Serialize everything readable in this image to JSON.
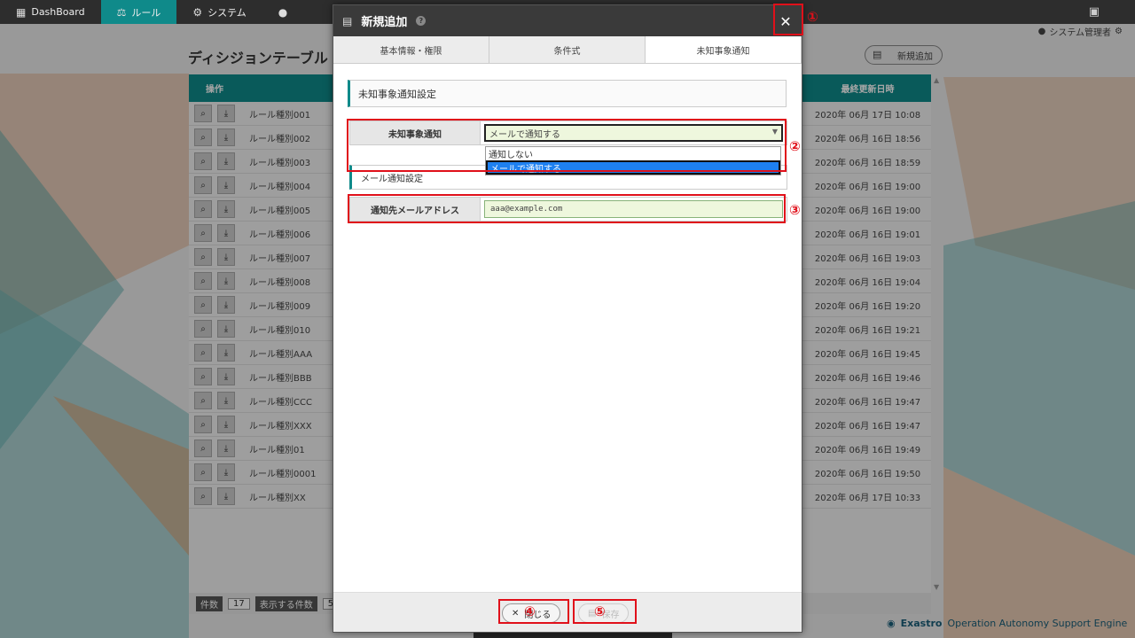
{
  "nav": {
    "items": [
      {
        "label": "DashBoard",
        "icon": "dashboard-icon",
        "active": false
      },
      {
        "label": "ルール",
        "icon": "scale-icon",
        "active": true
      },
      {
        "label": "システム",
        "icon": "gears-icon",
        "active": false
      }
    ]
  },
  "user": {
    "label": "システム管理者"
  },
  "page": {
    "title": "ディシジョンテーブル",
    "new_add_label": "新規追加"
  },
  "table": {
    "col_op": "操作",
    "col_date": "最終更新日時",
    "rows": [
      {
        "name": "ルール種別001",
        "date": "2020年 06月 17日 10:08"
      },
      {
        "name": "ルール種別002",
        "date": "2020年 06月 16日 18:56"
      },
      {
        "name": "ルール種別003",
        "date": "2020年 06月 16日 18:59"
      },
      {
        "name": "ルール種別004",
        "date": "2020年 06月 16日 19:00"
      },
      {
        "name": "ルール種別005",
        "date": "2020年 06月 16日 19:00"
      },
      {
        "name": "ルール種別006",
        "date": "2020年 06月 16日 19:01"
      },
      {
        "name": "ルール種別007",
        "date": "2020年 06月 16日 19:03"
      },
      {
        "name": "ルール種別008",
        "date": "2020年 06月 16日 19:04"
      },
      {
        "name": "ルール種別009",
        "date": "2020年 06月 16日 19:20"
      },
      {
        "name": "ルール種別010",
        "date": "2020年 06月 16日 19:21"
      },
      {
        "name": "ルール種別AAA",
        "date": "2020年 06月 16日 19:45"
      },
      {
        "name": "ルール種別BBB",
        "date": "2020年 06月 16日 19:46"
      },
      {
        "name": "ルール種別CCC",
        "date": "2020年 06月 16日 19:47"
      },
      {
        "name": "ルール種別XXX",
        "date": "2020年 06月 16日 19:47"
      },
      {
        "name": "ルール種別01",
        "date": "2020年 06月 16日 19:49"
      },
      {
        "name": "ルール種別0001",
        "date": "2020年 06月 16日 19:50"
      },
      {
        "name": "ルール種別XX",
        "date": "2020年 06月 17日 10:33"
      }
    ]
  },
  "footer": {
    "count_label": "件数",
    "count_value": "17",
    "display_label": "表示する件数",
    "display_value": "5"
  },
  "brand": {
    "name": "Exastro",
    "tagline": "Operation Autonomy Support Engine"
  },
  "modal": {
    "title": "新規追加",
    "help": "?",
    "close": "✕",
    "tabs": [
      "基本情報・権限",
      "条件式",
      "未知事象通知"
    ],
    "active_tab": 2,
    "section_title": "未知事象通知設定",
    "notify_label": "未知事象通知",
    "notify_value": "メールで通知する",
    "notify_options": [
      "通知しない",
      "メールで通知する"
    ],
    "mail_section": "メール通知設定",
    "mail_label": "通知先メールアドレス",
    "mail_value": "aaa@example.com",
    "close_btn": "閉じる",
    "save_btn": "保存"
  },
  "annotations": [
    "①",
    "②",
    "③",
    "④",
    "⑤"
  ],
  "colors": {
    "accent": "#0f8a8a",
    "annotation": "#e0101a",
    "selected_option": "#1e80f0"
  }
}
